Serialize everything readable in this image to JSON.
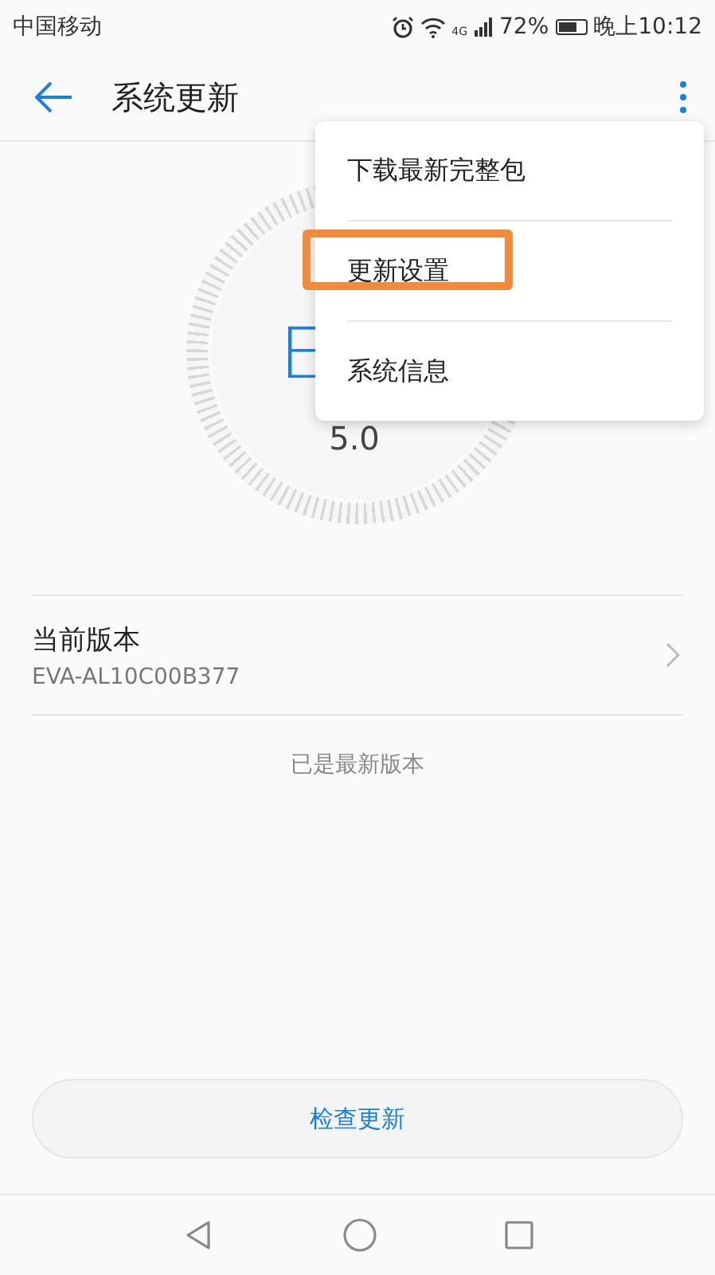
{
  "status_bar": {
    "carrier": "中国移动",
    "network": "4G",
    "battery": "72%",
    "time": "晚上10:12"
  },
  "toolbar": {
    "title": "系统更新"
  },
  "dial": {
    "label": "E",
    "version": "5.0"
  },
  "menu": {
    "items": [
      {
        "label": "下载最新完整包",
        "highlighted": false
      },
      {
        "label": "更新设置",
        "highlighted": true
      },
      {
        "label": "系统信息",
        "highlighted": false
      }
    ]
  },
  "version_row": {
    "title": "当前版本",
    "value": "EVA-AL10C00B377"
  },
  "status_text": "已是最新版本",
  "check_button": "检查更新"
}
